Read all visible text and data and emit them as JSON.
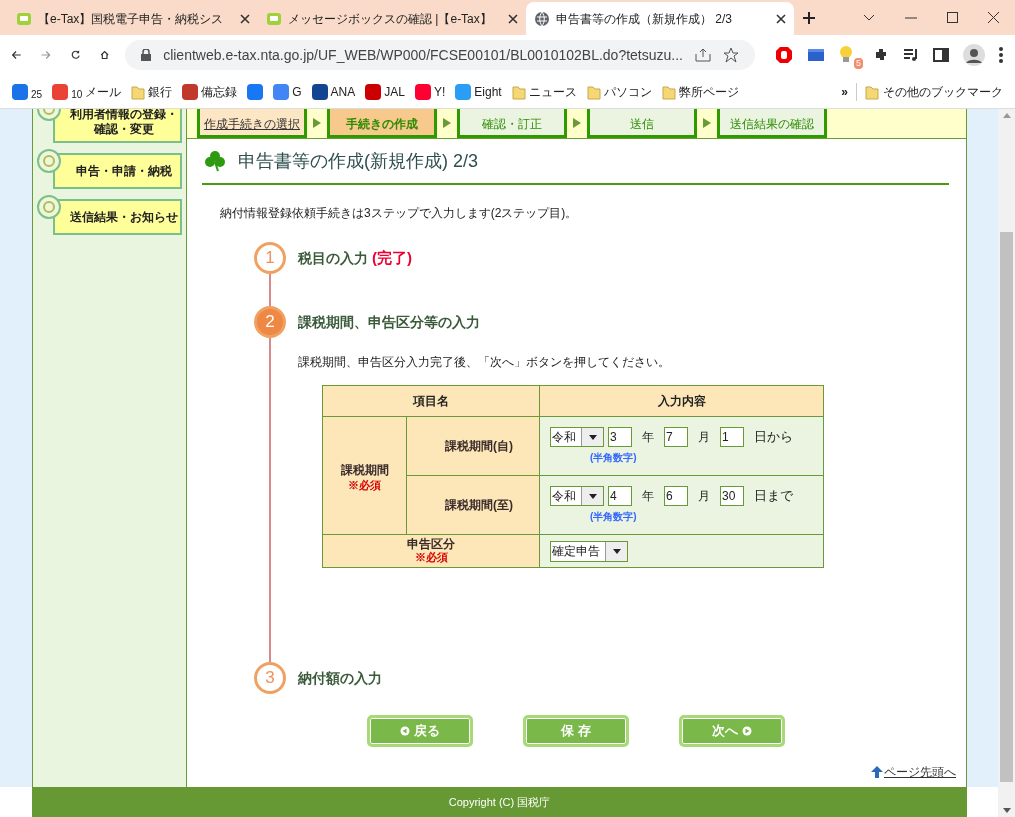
{
  "browser": {
    "tabs": [
      {
        "title": "【e-Tax】国税電子申告・納税シス",
        "kind": "site",
        "selected": false
      },
      {
        "title": "メッセージボックスの確認 |【e-Tax】",
        "kind": "site",
        "selected": false
      },
      {
        "title": "申告書等の作成（新規作成） 2/3",
        "kind": "page",
        "selected": true
      }
    ],
    "address": "clientweb.e-tax.nta.go.jp/UF_WEB/WP000/FCSE00101/BL0010102BL.do?tetsuzu...",
    "extension_badge": "5",
    "bookmarks": [
      {
        "kind": "site",
        "badge": "25",
        "color": "#1a73e8"
      },
      {
        "kind": "site",
        "badge": "10",
        "label": "メール",
        "color": "#ea4335"
      },
      {
        "kind": "folder",
        "label": "銀行"
      },
      {
        "kind": "site",
        "label": "備忘録",
        "color": "#c0392b"
      },
      {
        "kind": "site",
        "color": "#1877f2"
      },
      {
        "kind": "site",
        "label": "G",
        "color": "#4285f4"
      },
      {
        "kind": "site",
        "label": "ANA",
        "color": "#13448f"
      },
      {
        "kind": "site",
        "label": "JAL",
        "color": "#cc0000"
      },
      {
        "kind": "site",
        "label": "Y!",
        "color": "#ff0033"
      },
      {
        "kind": "site",
        "label": "Eight",
        "color": "#2a9df4"
      },
      {
        "kind": "folder",
        "label": "ニュース"
      },
      {
        "kind": "folder",
        "label": "パソコン"
      },
      {
        "kind": "folder",
        "label": "弊所ページ"
      }
    ],
    "more": "»",
    "other_bookmarks": "その他のブックマーク"
  },
  "sidebar": {
    "items": [
      {
        "label": "利用者情報の登録・確認・変更"
      },
      {
        "label": "申告・申請・納税"
      },
      {
        "label": "送信結果・お知らせ"
      }
    ]
  },
  "progress": [
    {
      "label": "作成手続きの選択",
      "completed": true,
      "selected": false
    },
    {
      "label": "手続きの作成",
      "completed": false,
      "selected": true
    },
    {
      "label": "確認・訂正",
      "completed": false,
      "selected": false
    },
    {
      "label": "送信",
      "completed": false,
      "selected": false
    },
    {
      "label": "送信結果の確認",
      "completed": false,
      "selected": false
    }
  ],
  "title": "申告書等の作成(新規作成) 2/3",
  "intro": "納付情報登録依頼手続きは3ステップで入力します(2ステップ目)。",
  "steps": [
    {
      "number": "1",
      "title": "税目の入力",
      "status_text": "(完了)",
      "active": false
    },
    {
      "number": "2",
      "title": "課税期間、申告区分等の入力",
      "active": true,
      "instruction": "課税期間、申告区分入力完了後、「次へ」ボタンを押してください。",
      "table": {
        "headers": [
          "項目名",
          "入力内容"
        ],
        "group": {
          "label": "課税期間",
          "required": "※必須",
          "rows": [
            {
              "label": "課税期間(自)",
              "era": "令和",
              "year": "3",
              "year_unit": "年",
              "month": "7",
              "month_unit": "月",
              "day": "1",
              "day_unit": "日から",
              "hint": "(半角数字)"
            },
            {
              "label": "課税期間(至)",
              "era": "令和",
              "year": "4",
              "year_unit": "年",
              "month": "6",
              "month_unit": "月",
              "day": "30",
              "day_unit": "日まで",
              "hint": "(半角数字)"
            }
          ]
        },
        "kubun": {
          "label": "申告区分",
          "required": "※必須",
          "value": "確定申告"
        }
      }
    },
    {
      "number": "3",
      "title": "納付額の入力",
      "active": false
    }
  ],
  "buttons": [
    {
      "label": "戻る",
      "kind": "back"
    },
    {
      "label": "保 存",
      "kind": "plain"
    },
    {
      "label": "次へ",
      "kind": "next"
    }
  ],
  "page_top": "ページ先頭へ",
  "footer": "Copyright (C) 国税庁"
}
